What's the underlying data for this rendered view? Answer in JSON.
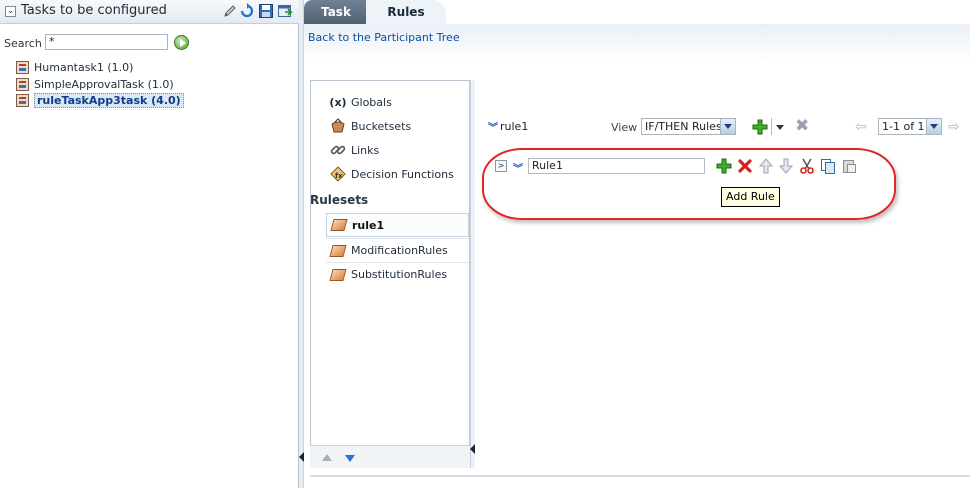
{
  "left_panel": {
    "title": "Tasks to be configured",
    "collapse_glyph": "⌄",
    "toolbar_icons": [
      "edit-icon",
      "refresh-icon",
      "save-icon",
      "deploy-icon"
    ],
    "search": {
      "label": "Search",
      "value": "*"
    },
    "tasks": [
      {
        "label": "Humantask1 (1.0)",
        "selected": false
      },
      {
        "label": "SimpleApprovalTask (1.0)",
        "selected": false
      },
      {
        "label": "ruleTaskApp3task (4.0)",
        "selected": true
      }
    ]
  },
  "tabs": [
    {
      "label": "Task",
      "active": false
    },
    {
      "label": "Rules",
      "active": true
    }
  ],
  "back_link": "Back to the Participant Tree",
  "dictionary": {
    "items": [
      {
        "label": "Globals",
        "icon": "x-variable-icon",
        "glyph": "(x)"
      },
      {
        "label": "Bucketsets",
        "icon": "bucketset-icon",
        "glyph": ""
      },
      {
        "label": "Links",
        "icon": "link-icon",
        "glyph": ""
      },
      {
        "label": "Decision Functions",
        "icon": "decision-function-icon",
        "glyph": ""
      }
    ],
    "rulesets_label": "Rulesets",
    "rulesets": [
      {
        "label": "rule1",
        "selected": true
      },
      {
        "label": "ModificationRules",
        "selected": false
      },
      {
        "label": "SubstitutionRules",
        "selected": false
      }
    ]
  },
  "ruleset_editor": {
    "ruleset_name": "rule1",
    "view_label": "View",
    "view_value": "IF/THEN Rules",
    "pagination": "1-1 of 1",
    "rule": {
      "expand_glyph": ">",
      "name": "Rule1"
    },
    "tooltip": "Add Rule"
  }
}
